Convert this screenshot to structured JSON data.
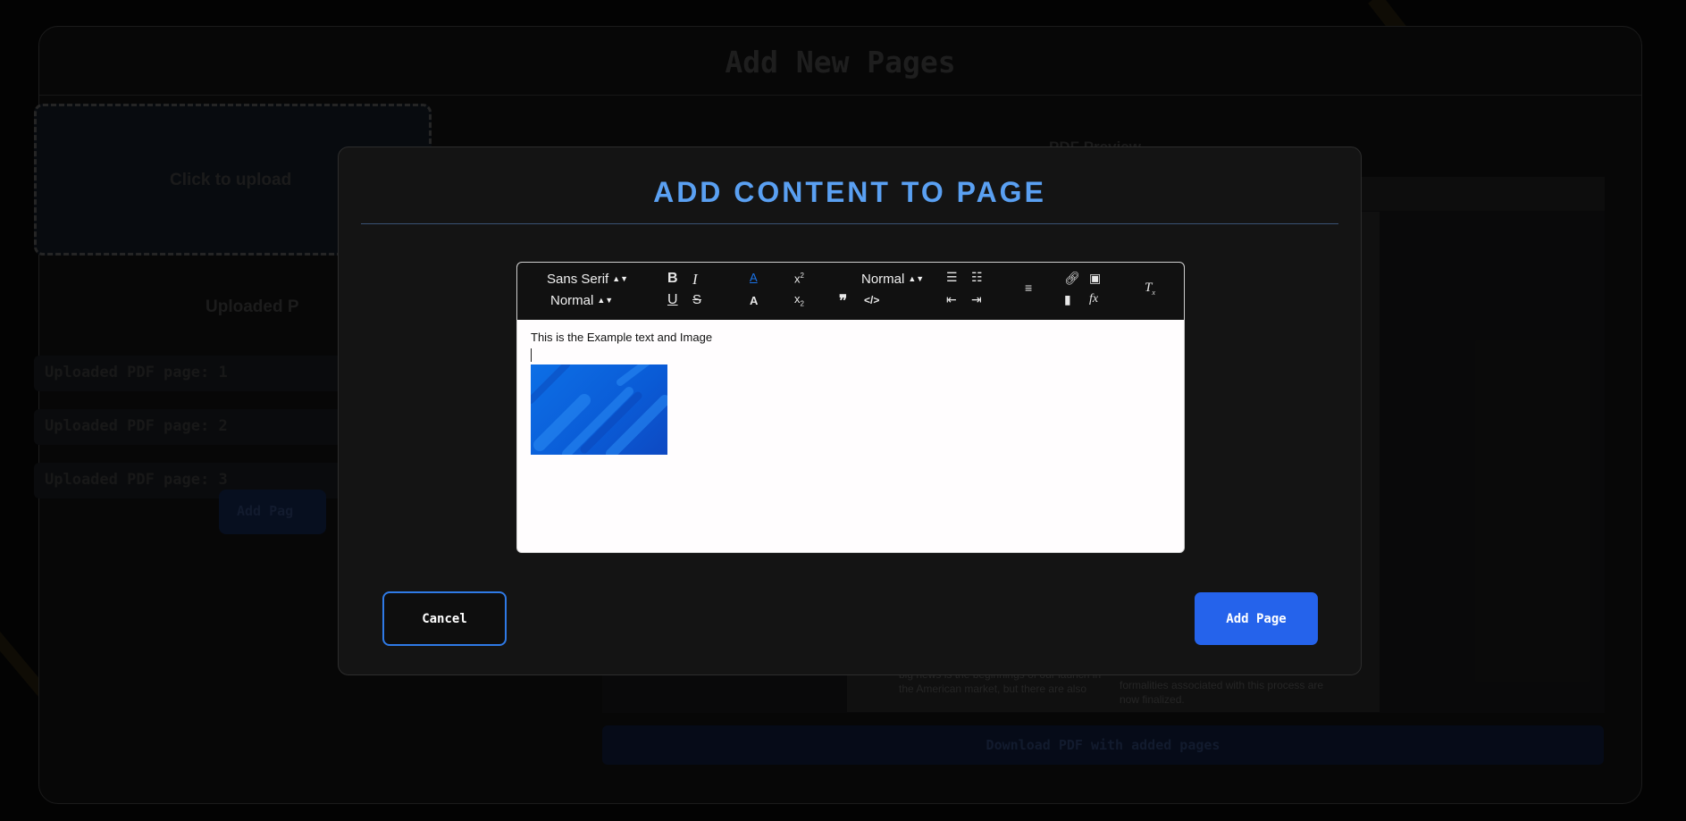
{
  "app": {
    "title": "Add New Pages",
    "upload_prompt": "Click to upload",
    "uploaded_heading": "Uploaded P",
    "uploaded_pages": [
      "Uploaded PDF page: 1",
      "Uploaded PDF page: 2",
      "Uploaded PDF page: 3"
    ],
    "add_pages_label": "Add Pag",
    "pdf_preview_label": "PDF Preview",
    "download_label": "Download PDF with added pages",
    "pdf_snippet_left": "big news is the beginnings of our launch in the American market, but there are also",
    "pdf_snippet_right": "formalities associated with this process are now finalized."
  },
  "modal": {
    "title": "ADD CONTENT TO PAGE",
    "cancel_label": "Cancel",
    "add_page_label": "Add Page"
  },
  "editor": {
    "font_select": "Sans Serif",
    "size_select": "Normal",
    "header_select": "Normal",
    "content_text": "This is the Example text and Image",
    "accent_color": "#1a73e8"
  }
}
